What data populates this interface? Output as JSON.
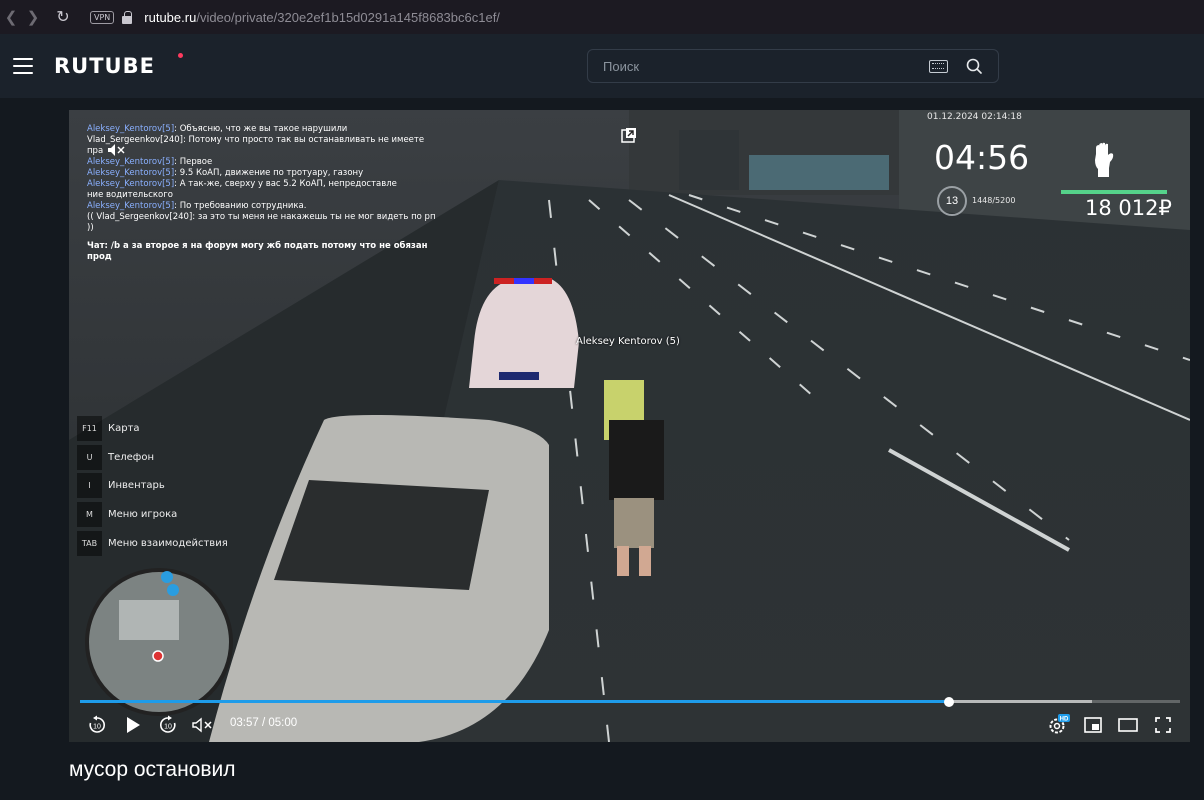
{
  "browser": {
    "url_host": "rutube.ru",
    "url_path": "/video/private/320e2ef1b15d0291a145f8683bc6c1ef/",
    "vpn_label": "VPN"
  },
  "header": {
    "logo": "RUTUBE",
    "search_placeholder": "Поиск"
  },
  "game_hud": {
    "chat": [
      {
        "name": "Aleksey_Kentorov[5]",
        "text": ": Объясню, что же вы такое нарушили"
      },
      {
        "name": "",
        "text": "Vlad_Sergeenkov[240]: Потому что просто так вы останавливать не имеете"
      },
      {
        "name": "",
        "text": "пра"
      },
      {
        "name": "Aleksey_Kentorov[5]",
        "text": ": Первое"
      },
      {
        "name": "Aleksey_Kentorov[5]",
        "text": ": 9.5 КоАП, движение по тротуару, газону"
      },
      {
        "name": "Aleksey_Kentorov[5]",
        "text": ": А так-же, сверху у вас 5.2 КоАП, непредоставле"
      },
      {
        "name": "",
        "text": "ние водительского"
      },
      {
        "name": "Aleksey_Kentorov[5]",
        "text": ": По требованию сотрудника."
      },
      {
        "name": "",
        "text": "(( Vlad_Sergeenkov[240]: за это ты меня не накажешь ты не мог видеть по рп"
      },
      {
        "name": "",
        "text": " ))"
      }
    ],
    "chat_input": "Чат: /b а за второе я на форум могу жб подать потому что не обязан прод",
    "date": "01.12.2024 02:14:18",
    "clock": "04:56",
    "level": "13",
    "xp": "1448/5200",
    "health_fraction": 1.0,
    "money": "18 012₽",
    "player_nametag": "Aleksey Kentorov (5)",
    "menu": [
      {
        "key": "F11",
        "label": "Карта"
      },
      {
        "key": "U",
        "label": "Телефон"
      },
      {
        "key": "I",
        "label": "Инвентарь"
      },
      {
        "key": "M",
        "label": "Меню игрока"
      },
      {
        "key": "TAB",
        "label": "Меню взаимодействия"
      }
    ]
  },
  "player": {
    "current_time": "03:57",
    "duration": "05:00",
    "played_fraction": 0.79,
    "buffered_fraction": 0.92,
    "rewind_seconds": "10",
    "forward_seconds": "10",
    "quality_badge": "HD"
  },
  "video": {
    "title": "мусор остановил"
  },
  "colors": {
    "accent": "#1e9cea",
    "logo_dot": "#ff3a5e",
    "chat_name": "#8ab0ff"
  }
}
